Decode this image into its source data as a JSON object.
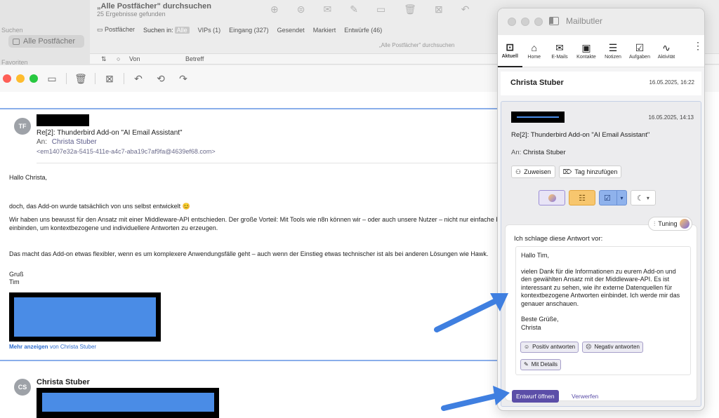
{
  "search_window": {
    "sidebar_section_search": "Suchen",
    "sidebar_mailbox": "Alle Postfächer",
    "sidebar_section_favorites": "Favoriten",
    "title": "„Alle Postfächer\" durchsuchen",
    "result_count": "25 Ergebnisse gefunden",
    "filters": {
      "mailboxes": "Postfächer",
      "search_in": "Suchen in:",
      "all": "Alle",
      "vips": "VIPs (1)",
      "inbox": "Eingang (327)",
      "sent": "Gesendet",
      "flagged": "Markiert",
      "drafts": "Entwürfe (46)"
    },
    "hint": "„Alle Postfächer\" durchsuchen",
    "columns": {
      "sort": "⇅",
      "status": "○",
      "from": "Von",
      "subject": "Betreff"
    }
  },
  "message": {
    "sender_initials": "TF",
    "subject": "Re[2]: Thunderbird Add-on \"AI Email Assistant\"",
    "to_label": "An:",
    "to_value": "Christa Stuber",
    "message_id": "<em1407e32a-5415-411e-a4c7-aba19c7af9fa@4639ef68.com>",
    "body": {
      "greeting": "Hallo Christa,",
      "line1": "doch, das Add-on wurde tatsächlich von uns selbst entwickelt 😊",
      "line2a": "Wir haben uns bewusst für den Ansatz mit einer Middleware-API entschieden. Der große Vorteil: Mit Tools wie n8n können wir – oder auch unsere Nutzer – nicht nur einfache Prompts",
      "line2b": "einbinden, um kontextbezogene und individuellere Antworten zu erzeugen.",
      "line3": "Das macht das Add-on etwas flexibler, wenn es um komplexere Anwendungsfälle geht – auch wenn der Einstieg etwas technischer ist als bei anderen Lösungen wie Hawk.",
      "signoff": "Gruß",
      "name": "Tim"
    },
    "show_more": "Mehr anzeigen",
    "show_more_from": "von Christa Stuber",
    "second_initials": "CS",
    "second_name": "Christa Stuber"
  },
  "mailbutler": {
    "title": "Mailbutler",
    "nav": [
      {
        "label": "Aktuell",
        "icon": "inbox-icon"
      },
      {
        "label": "Home",
        "icon": "home-icon"
      },
      {
        "label": "E-Mails",
        "icon": "mail-icon"
      },
      {
        "label": "Kontakte",
        "icon": "contacts-icon"
      },
      {
        "label": "Notizen",
        "icon": "notes-icon"
      },
      {
        "label": "Aufgaben",
        "icon": "tasks-icon"
      },
      {
        "label": "Aktivität",
        "icon": "activity-icon"
      }
    ],
    "contact_name": "Christa Stuber",
    "contact_time": "16.05.2025, 16:22",
    "card": {
      "time": "16.05.2025, 14:13",
      "subject": "Re[2]: Thunderbird Add-on \"AI Email Assistant\"",
      "to_label": "An:",
      "to_value": "Christa Stuber",
      "assign": "Zuweisen",
      "add_tag": "Tag hinzufügen"
    },
    "tuning": "Tuning",
    "suggest_label": "Ich schlage diese Antwort vor:",
    "reply": {
      "greeting": "Hallo Tim,",
      "paragraph": "vielen Dank für die Informationen zu eurem Add-on und den gewählten Ansatz mit der Middleware-API. Es ist interessant zu sehen, wie ihr externe Datenquellen für kontextbezogene Antworten einbindet. Ich werde mir das genauer anschauen.",
      "closing": "Beste Grüße,",
      "signature": "Christa"
    },
    "tones": {
      "positive": "Positiv antworten",
      "negative": "Negativ antworten",
      "details": "Mit Details"
    },
    "open_draft": "Entwurf öffnen",
    "discard": "Verwerfen",
    "colors": {
      "accent": "#5b4ea8",
      "note": "#f7c66e",
      "task": "#8fb2ec"
    }
  }
}
